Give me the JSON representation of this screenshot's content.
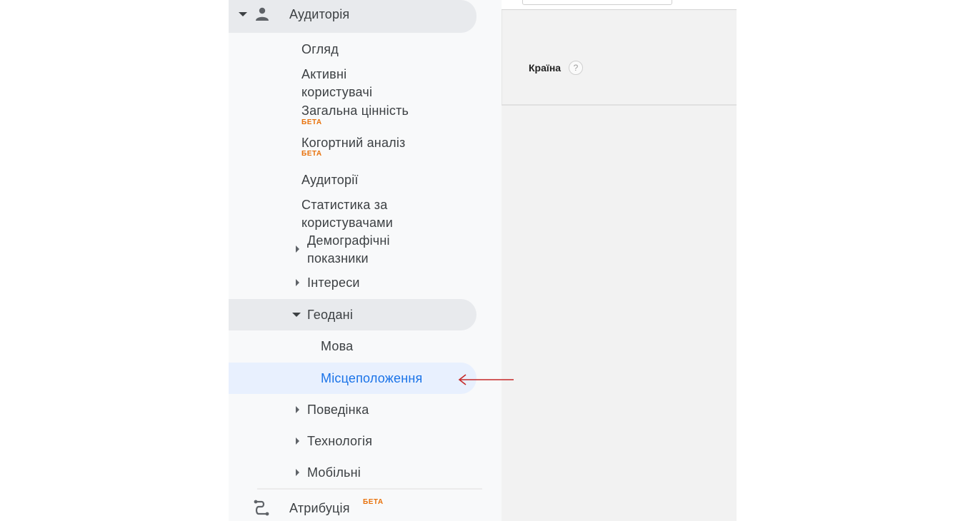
{
  "nav": {
    "section": {
      "label": "Аудиторія",
      "icon": "person-icon"
    },
    "items": {
      "overview": "Огляд",
      "active_users_1": "Активні",
      "active_users_2": "користувачі",
      "lifetime_value": "Загальна цінність",
      "cohort": "Когортний аналіз",
      "audiences": "Аудиторії",
      "user_explorer_1": "Статистика за",
      "user_explorer_2": "користувачами",
      "demographics_1": "Демографічні",
      "demographics_2": "показники",
      "interests": "Інтереси",
      "geo": "Геодані",
      "language": "Мова",
      "location": "Місцеположення",
      "behavior": "Поведінка",
      "technology": "Технологія",
      "mobile": "Мобільні"
    },
    "beta_label": "БЕТА",
    "attribution": {
      "label": "Атрибуція",
      "beta": "БЕТА",
      "icon": "attribution-icon"
    }
  },
  "main": {
    "dimension_label": "Країна",
    "help_glyph": "?"
  },
  "colors": {
    "accent": "#1a73e8",
    "beta": "#e8710a",
    "arrow": "#c62828"
  }
}
